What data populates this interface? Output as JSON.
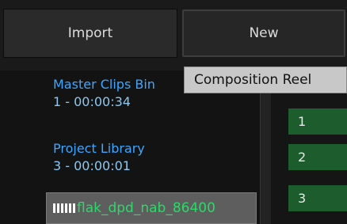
{
  "toolbar": {
    "import_label": "Import",
    "new_label": "New"
  },
  "tooltip": {
    "text": "Composition Reel"
  },
  "bins": [
    {
      "name": "Master Clips Bin",
      "count": "1 - 00:00:34"
    },
    {
      "name": "Project Library",
      "count": "3 - 00:00:01"
    }
  ],
  "selected_clip": {
    "icon": "filmstrip-icon",
    "name": "flak_dpd_nab_86400"
  },
  "reels": [
    "1",
    "2",
    "3"
  ],
  "colors": {
    "bin_text": "#3ea6ff",
    "clip_text": "#2bd96a",
    "reel_bg": "#1d5c2c"
  }
}
